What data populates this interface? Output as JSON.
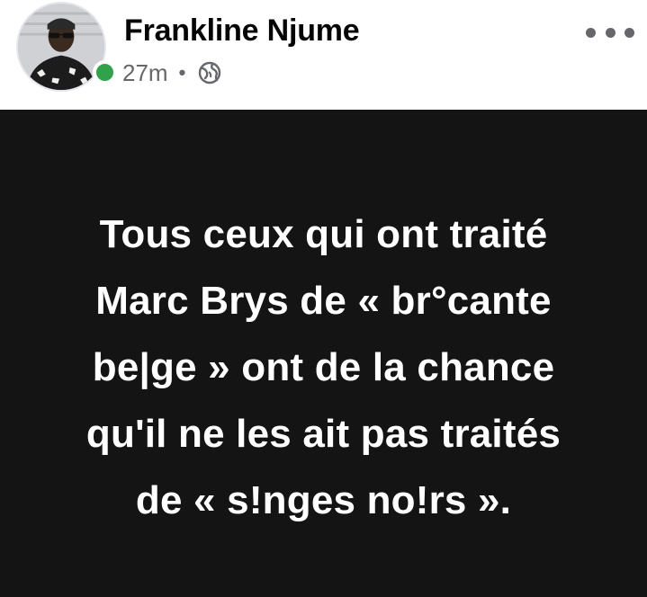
{
  "post": {
    "author": "Frankline Njume",
    "time": "27m",
    "separator": "•",
    "online": true,
    "audience_icon": "globe-icon",
    "more_icon": "more-options-icon",
    "text_lines": [
      "Tous ceux qui ont traité",
      "Marc Brys de « br°cante",
      "be|ge » ont de la chance",
      "qu'il ne les ait pas traités",
      "de « s!nges no!rs »."
    ],
    "background_color": "#141414",
    "text_color": "#ffffff"
  }
}
